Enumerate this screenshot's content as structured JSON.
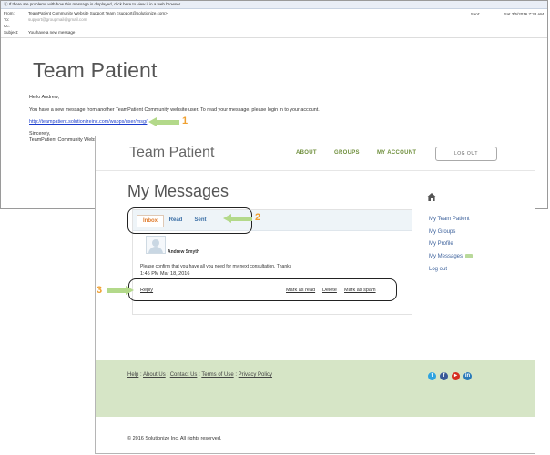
{
  "email": {
    "banner": "If there are problems with how this message is displayed, click here to view it in a web browser.",
    "from_label": "From:",
    "from_value": "TeamPatient Community Website Support Team <support@solutionize.com>",
    "to_label": "To:",
    "to_value": "support@groupmail@gmail.com",
    "cc_label": "Cc:",
    "subject_label": "Subject:",
    "subject_value": "You have a new message",
    "sent_label": "Sent:",
    "sent_value": "Sat 3/5/2016 7:38 AM",
    "brand": "Team Patient",
    "greeting": "Hello Andrew,",
    "body_text": "You have a new message from another TeamPatient Community website user. To read your message, please login in to your account.",
    "link": "http://teampatient.solutionizeinc.com/wapps/user/msg/",
    "sincerely": "Sincerely,",
    "signature": "TeamPatient Community Website"
  },
  "callouts": {
    "n1": "1",
    "n2": "2",
    "n3": "3"
  },
  "site": {
    "brand": "Team Patient",
    "nav": {
      "about": "ABOUT",
      "groups": "GROUPS",
      "account": "MY ACCOUNT",
      "logout": "LOG OUT"
    },
    "page_title": "My Messages",
    "tabs": {
      "inbox": "Inbox",
      "read": "Read",
      "sent": "Sent"
    },
    "message": {
      "sender": "Andrew Smyth",
      "body": "Please confirm that you have all you need for my next consultation. Thanks",
      "time": "1:45 PM Mar 18, 2016"
    },
    "actions": {
      "reply": "Reply",
      "mark_read": "Mark as read",
      "delete": "Delete",
      "mark_spam": "Mark as spam"
    },
    "sidebar": [
      "My Team Patient",
      "My Groups",
      "My Profile",
      "My Messages",
      "Log out"
    ],
    "footer_links": {
      "help": "Help",
      "about": "About Us",
      "contact": "Contact Us",
      "terms": "Terms of Use",
      "privacy": "Privacy Policy",
      "sep": " : "
    },
    "social": [
      "twitter-icon",
      "facebook-icon",
      "youtube-icon",
      "linkedin-icon"
    ],
    "copyright": "© 2016 Solutionize Inc. All rights reserved."
  },
  "colors": {
    "accent": "#6f8f3c",
    "tab_active": "#e07b2c",
    "footer_bg": "#d6e5c6",
    "arrow": "#b3d98a",
    "callout": "#f0a030"
  }
}
